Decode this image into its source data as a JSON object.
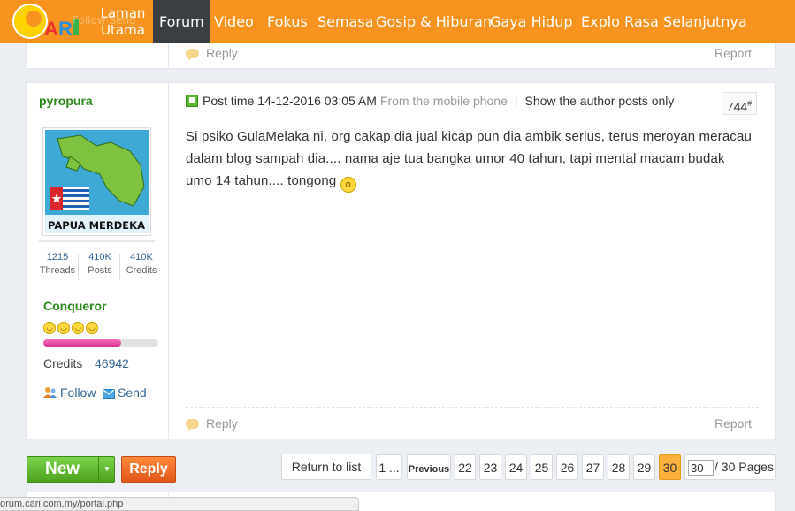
{
  "nav": {
    "logo_text": "CARI",
    "ghost_text": "Follow Send",
    "items": [
      {
        "label_line1": "Laman",
        "label_line2": "Utama"
      },
      {
        "label": "Forum"
      },
      {
        "label": "Video"
      },
      {
        "label": "Fokus"
      },
      {
        "label": "Semasa"
      },
      {
        "label": "Gosip & Hiburan"
      },
      {
        "label": "Gaya Hidup"
      },
      {
        "label": "Explo Rasa"
      },
      {
        "label": "Selanjutnya"
      }
    ],
    "active_index": 1
  },
  "prev_post": {
    "reply_label": "Reply",
    "report_label": "Report"
  },
  "post": {
    "author": "pyropura",
    "avatar_text": "PAPUA MERDEKA",
    "stats": [
      {
        "value": "1215",
        "label": "Threads"
      },
      {
        "value": "410K",
        "label": "Posts"
      },
      {
        "value": "410K",
        "label": "Credits"
      }
    ],
    "rank": "Conqueror",
    "rank_progress": 0.68,
    "credits_label": "Credits",
    "credits_value": "46942",
    "follow_label": "Follow",
    "send_label": "Send",
    "post_time_label": "Post time",
    "post_time": "14-12-2016 03:05 AM",
    "mobile_label": "From the mobile phone",
    "author_only_label": "Show the author posts only",
    "floor": "744",
    "floor_suffix": "#",
    "body_text": "Si psiko GulaMelaka ni, org cakap dia jual kicap pun dia ambik serius, terus meroyan meracau dalam blog sampah dia.... nama aje tua bangka umor 40 tahun, tapi mental macam budak umo 14 tahun.... tongong",
    "reply_label": "Reply",
    "report_label": "Report"
  },
  "actions": {
    "new_label": "New",
    "reply_label": "Reply"
  },
  "pagination": {
    "return_label": "Return to list",
    "first_label": "1 ...",
    "prev_label": "Previous",
    "pages": [
      "22",
      "23",
      "24",
      "25",
      "26",
      "27",
      "28",
      "29",
      "30"
    ],
    "current": "30",
    "input_value": "30",
    "total_label": "/ 30 Pages"
  },
  "status_bar": {
    "url": "orum.cari.com.my/portal.php"
  },
  "colors": {
    "nav_bg": "#f7931e",
    "nav_active": "#3a3f44",
    "green": "#2c8a1c",
    "link": "#336699",
    "current_page": "#fbb13b"
  }
}
